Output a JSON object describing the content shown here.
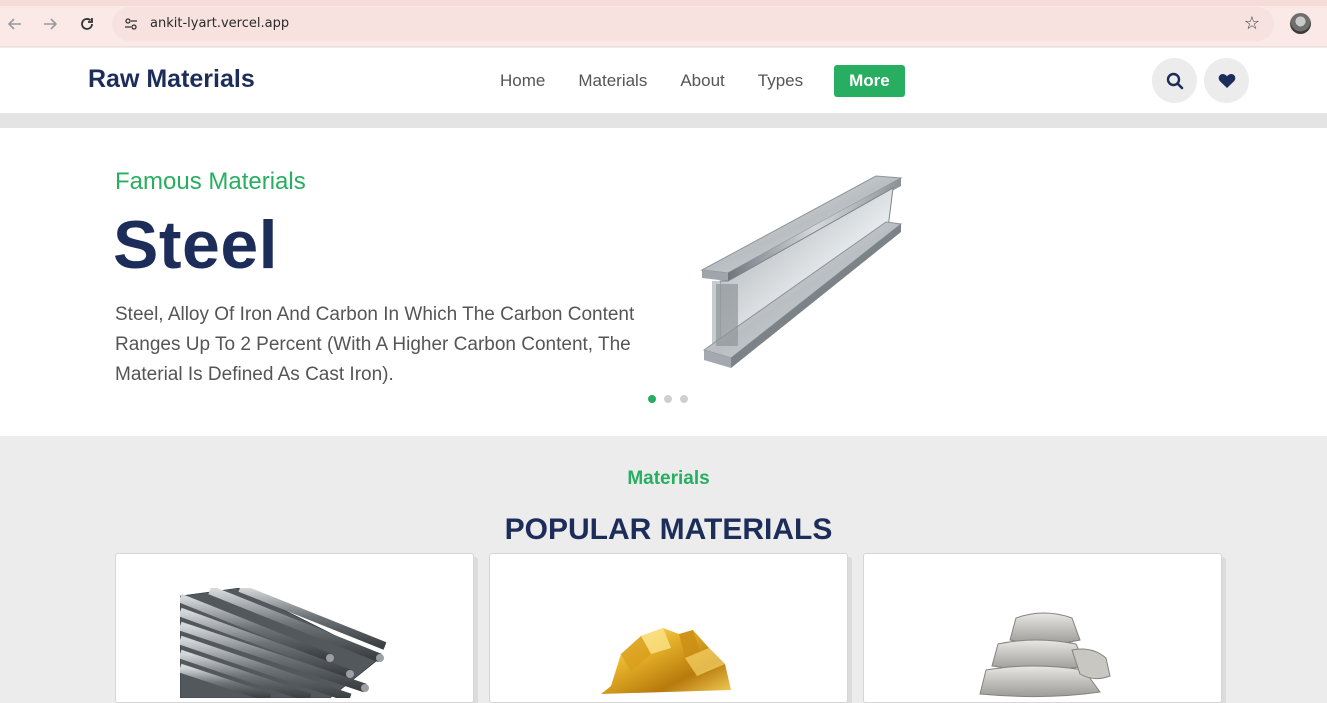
{
  "browser": {
    "url": "ankit-lyart.vercel.app"
  },
  "header": {
    "brand": "Raw Materials",
    "nav": [
      "Home",
      "Materials",
      "About",
      "Types"
    ],
    "more_label": "More"
  },
  "hero": {
    "eyebrow": "Famous Materials",
    "title": "Steel",
    "description": "Steel, Alloy Of Iron And Carbon In Which The Carbon Content Ranges Up To 2 Percent (With A Higher Carbon Content, The Material Is Defined As Cast Iron).",
    "carousel": {
      "slides": 3,
      "active": 1
    }
  },
  "materials": {
    "eyebrow": "Materials",
    "title": "POPULAR MATERIALS",
    "cards": [
      {
        "image": "steel-rebar-image"
      },
      {
        "image": "gold-nugget-image"
      },
      {
        "image": "cement-bags-image"
      }
    ]
  },
  "colors": {
    "accent": "#27ae60",
    "navy": "#1d2d5a"
  }
}
